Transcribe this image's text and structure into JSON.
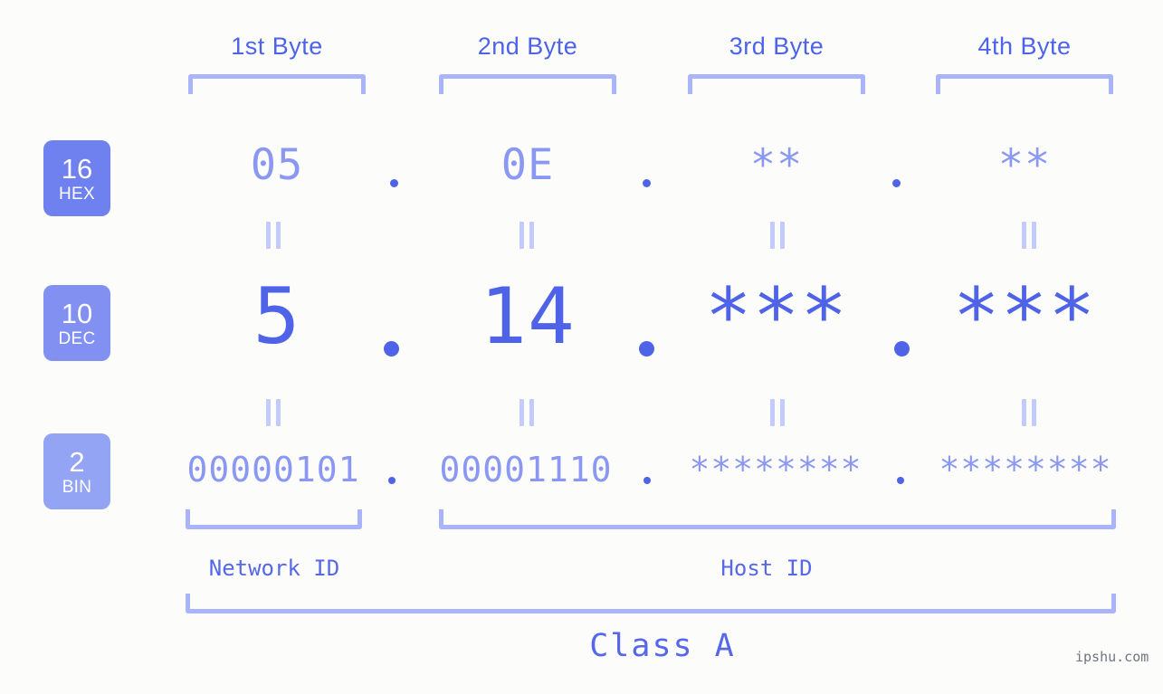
{
  "meta": {
    "background_color": "#fcfdfa",
    "accent_color": "#4f63e8",
    "muted_accent_color": "#8b98f3",
    "bracket_color": "#aab4fb"
  },
  "byte_headers": [
    {
      "label": "1st Byte"
    },
    {
      "label": "2nd Byte"
    },
    {
      "label": "3rd Byte"
    },
    {
      "label": "4th Byte"
    }
  ],
  "rows": [
    {
      "key": "hex",
      "badge": {
        "number": "16",
        "name": "HEX",
        "color": "#6f80ef"
      },
      "values": [
        "05",
        "0E",
        "**",
        "**"
      ],
      "separator": "."
    },
    {
      "key": "dec",
      "badge": {
        "number": "10",
        "name": "DEC",
        "color": "#8290f1"
      },
      "values": [
        "5",
        "14",
        "***",
        "***"
      ],
      "separator": "."
    },
    {
      "key": "bin",
      "badge": {
        "number": "2",
        "name": "BIN",
        "color": "#93a4f5"
      },
      "values": [
        "00000101",
        "00001110",
        "********",
        "********"
      ],
      "separator": "."
    }
  ],
  "equality_symbol": "‖",
  "id_sections": [
    {
      "label": "Network ID"
    },
    {
      "label": "Host ID"
    }
  ],
  "class_section": {
    "label": "Class A"
  },
  "watermark": {
    "text": "ipshu.com"
  }
}
